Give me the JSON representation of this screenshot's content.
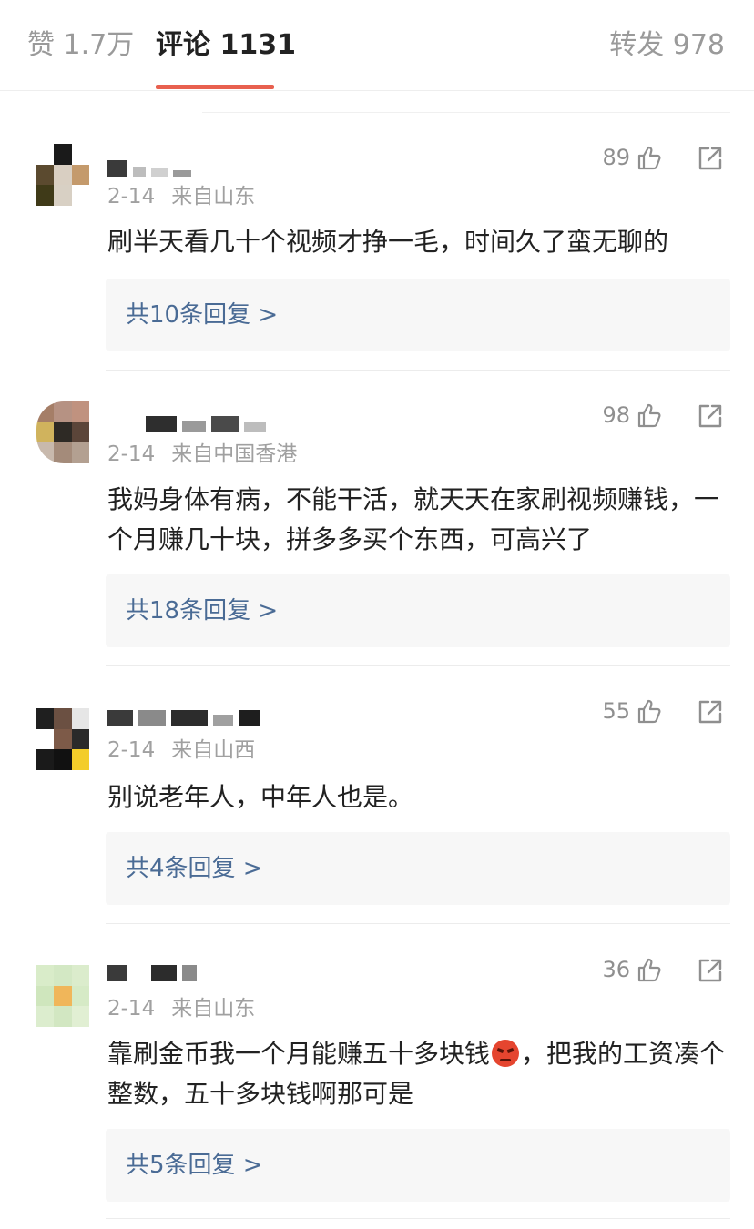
{
  "tabs": {
    "likes": "赞 1.7万",
    "comments": "评论 1131",
    "reposts": "转发 978",
    "accent_color": "#e8604f"
  },
  "icons": {
    "like": "thumbs-up-icon",
    "share": "share-arrow-icon"
  },
  "comments": [
    {
      "date": "2-14",
      "location": "来自山东",
      "likes": "89",
      "text": "刷半天看几十个视频才挣一毛，时间久了蛮无聊的",
      "replies": "共10条回复 >"
    },
    {
      "date": "2-14",
      "location": "来自中国香港",
      "likes": "98",
      "text": "我妈身体有病，不能干活，就天天在家刷视频赚钱，一个月赚几十块，拼多多买个东西，可高兴了",
      "replies": "共18条回复 >"
    },
    {
      "date": "2-14",
      "location": "来自山西",
      "likes": "55",
      "text": "别说老年人，中年人也是。",
      "replies": "共4条回复 >"
    },
    {
      "date": "2-14",
      "location": "来自山东",
      "likes": "36",
      "text_before": "靠刷金币我一个月能赚五十多块钱",
      "emoji": "angry-face-emoji",
      "text_after": "，把我的工资凑个整数，五十多块钱啊那可是",
      "replies": "共5条回复 >"
    }
  ]
}
